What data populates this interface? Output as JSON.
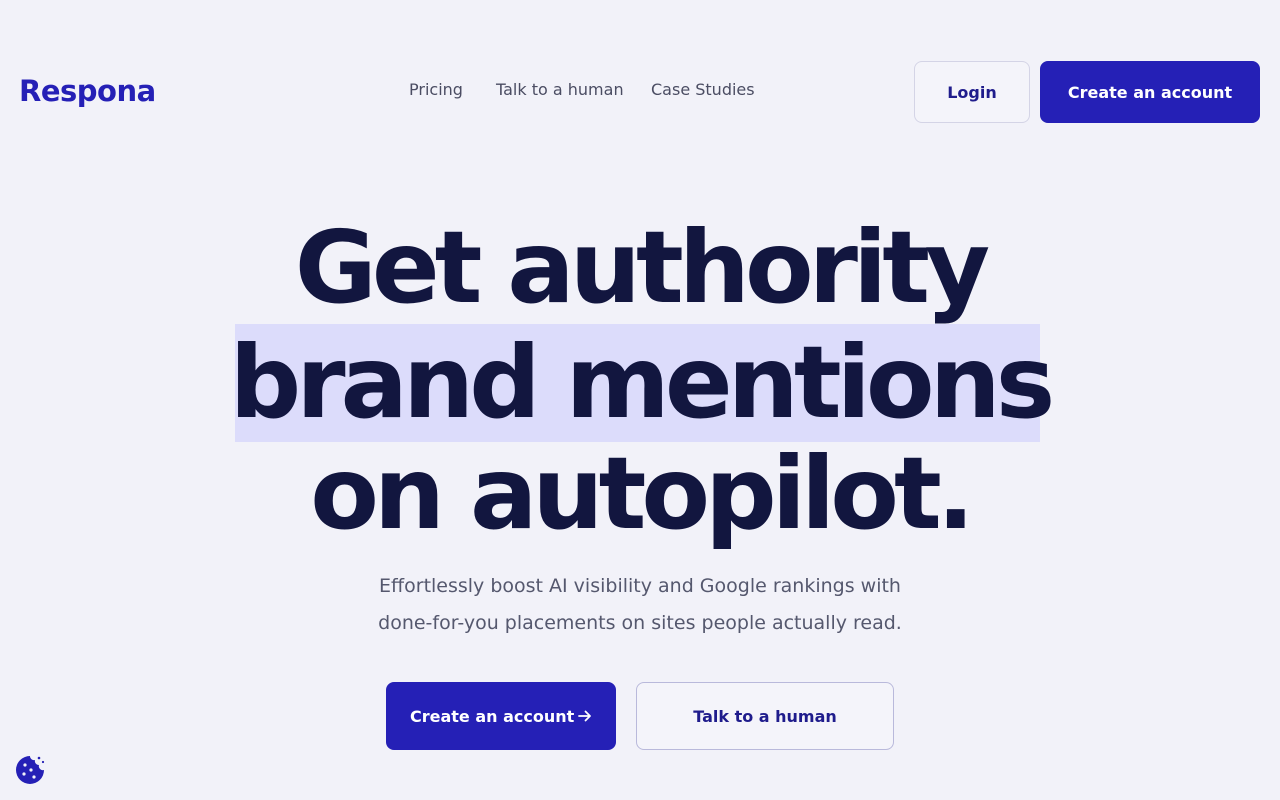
{
  "header": {
    "logo_text": "Respona",
    "nav": [
      {
        "label": "Pricing"
      },
      {
        "label": "Talk to a human"
      },
      {
        "label": "Case Studies"
      }
    ],
    "login_label": "Login",
    "create_account_label": "Create an account"
  },
  "hero": {
    "headline_line1": "Get authority",
    "headline_line2": "brand mentions",
    "headline_line3": "on autopilot.",
    "subtitle_line1": "Effortlessly boost AI visibility and Google rankings with",
    "subtitle_line2": "done-for-you placements on sites people actually read.",
    "cta_primary_label": "Create an account",
    "cta_secondary_label": "Talk to a human"
  },
  "icons": {
    "arrow": "arrow-right-icon",
    "cookie": "cookie-icon"
  },
  "colors": {
    "brand": "#2520b6",
    "background": "#f2f2f9",
    "headline": "#12163f",
    "highlight": "#dcdcfb"
  }
}
